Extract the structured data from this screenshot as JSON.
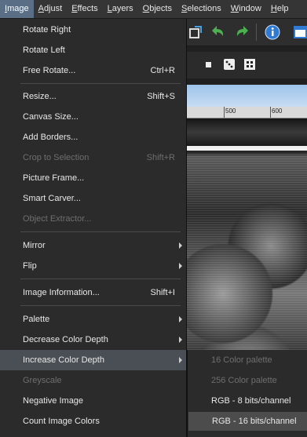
{
  "menubar": {
    "items": [
      {
        "label": "Image",
        "mnemonic": "I",
        "rest": "mage",
        "active": true
      },
      {
        "label": "Adjust",
        "mnemonic": "A",
        "rest": "djust"
      },
      {
        "label": "Effects",
        "mnemonic": "E",
        "rest": "ffects"
      },
      {
        "label": "Layers",
        "mnemonic": "L",
        "rest": "ayers"
      },
      {
        "label": "Objects",
        "mnemonic": "O",
        "rest": "bjects"
      },
      {
        "label": "Selections",
        "mnemonic": "S",
        "rest": "elections"
      },
      {
        "label": "Window",
        "mnemonic": "W",
        "rest": "indow"
      },
      {
        "label": "Help",
        "mnemonic": "H",
        "rest": "elp"
      }
    ]
  },
  "image_menu": {
    "items": [
      {
        "label": "Rotate Right",
        "shortcut": ""
      },
      {
        "label": "Rotate Left",
        "shortcut": ""
      },
      {
        "label": "Free Rotate...",
        "shortcut": "Ctrl+R"
      },
      {
        "label": "Resize...",
        "shortcut": "Shift+S"
      },
      {
        "label": "Canvas Size...",
        "shortcut": ""
      },
      {
        "label": "Add Borders...",
        "shortcut": ""
      },
      {
        "label": "Crop to Selection",
        "shortcut": "Shift+R"
      },
      {
        "label": "Picture Frame...",
        "shortcut": ""
      },
      {
        "label": "Smart Carver...",
        "shortcut": ""
      },
      {
        "label": "Object Extractor...",
        "shortcut": ""
      },
      {
        "label": "Mirror",
        "shortcut": ""
      },
      {
        "label": "Flip",
        "shortcut": ""
      },
      {
        "label": "Image Information...",
        "shortcut": "Shift+I"
      },
      {
        "label": "Palette",
        "shortcut": ""
      },
      {
        "label": "Decrease Color Depth",
        "shortcut": ""
      },
      {
        "label": "Increase Color Depth",
        "shortcut": ""
      },
      {
        "label": "Greyscale",
        "shortcut": ""
      },
      {
        "label": "Negative Image",
        "shortcut": ""
      },
      {
        "label": "Count Image Colors",
        "shortcut": ""
      }
    ]
  },
  "submenu": {
    "items": [
      {
        "label": "16 Color palette"
      },
      {
        "label": "256 Color palette"
      },
      {
        "label": "RGB - 8 bits/channel"
      },
      {
        "label": "RGB - 16 bits/channel"
      }
    ]
  },
  "ruler": {
    "labels": [
      "500",
      "600"
    ]
  },
  "colors": {
    "menu_bg": "#2b2b2b",
    "menubar_active": "#5a6f86",
    "highlight": "#4a4f55",
    "disabled_text": "#6e6e6e"
  }
}
